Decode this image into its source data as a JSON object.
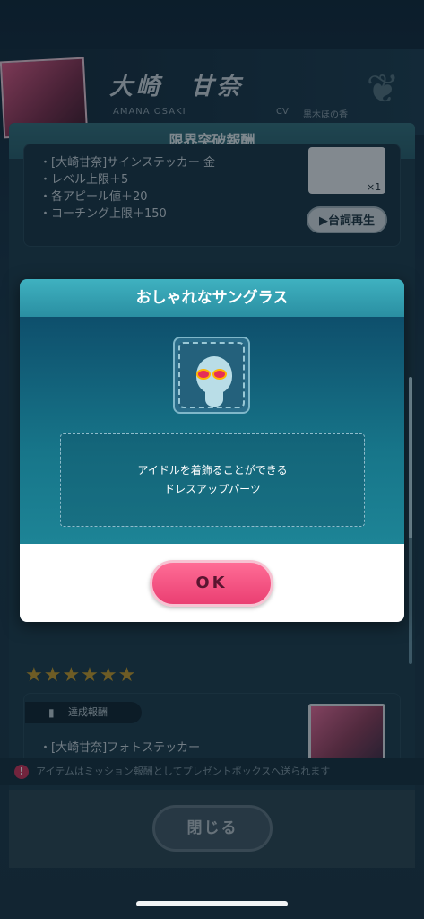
{
  "background": {
    "character_name": "大崎　甘奈",
    "character_roman": "AMANA OSAKI",
    "cv_label": "CV",
    "cv_name": "黒木ほの香",
    "panel_title": "限界突破報酬",
    "reward_lines": [
      "・[大崎甘奈]サインステッカー 金",
      "・レベル上限＋5",
      "・各アピール値＋20",
      "・コーチング上限＋150"
    ],
    "reward_count": "×1",
    "replay_button": "▶台詞再生",
    "stars": "★★★★★★",
    "mission_tag": "達成報酬",
    "mission_item": "・[大崎甘奈]フォトステッカー",
    "notice_text": "アイテムはミッション報酬としてプレゼントボックスへ送られます",
    "notice_icon": "!",
    "close_button": "閉じる"
  },
  "modal": {
    "title": "おしゃれなサングラス",
    "description_line1": "アイドルを着飾ることができる",
    "description_line2": "ドレスアップパーツ",
    "ok_button": "OK"
  },
  "colors": {
    "modal_header": "#2a8fa2",
    "ok_button": "#ea3f72",
    "star_gold": "#c29a2e"
  }
}
